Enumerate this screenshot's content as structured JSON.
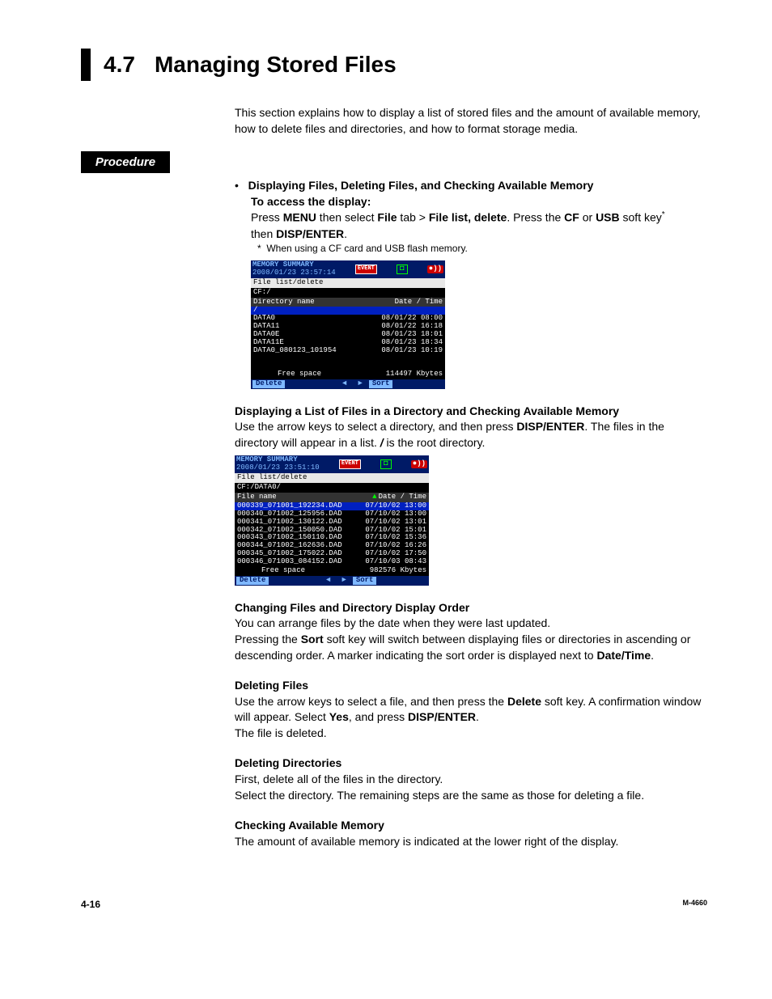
{
  "section": {
    "number": "4.7",
    "title": "Managing Stored Files"
  },
  "intro": "This section explains how to display a list of stored files and the amount of available memory, how to delete files and directories, and how to format storage media.",
  "procedure_label": "Procedure",
  "proc1": {
    "heading": "Displaying Files, Deleting Files, and Checking Available Memory",
    "line2": "To access the display:",
    "press": "Press ",
    "menu": "MENU",
    "then_select": " then select ",
    "file": "File",
    "tab_gt": " tab > ",
    "file_list_delete": "File list, delete",
    "press_the": ". Press the ",
    "cf": "CF",
    "or": " or ",
    "usb": "USB",
    "soft_key": " soft key",
    "then": "then ",
    "disp_enter": "DISP/ENTER",
    "period": ".",
    "footnote_mark": "*",
    "footnote": "When using a CF card and USB flash memory."
  },
  "screen1": {
    "title1": "MEMORY SUMMARY",
    "title2": "2008/01/23 23:57:14",
    "event": "EVENT",
    "subbar": "File list/delete",
    "path": "CF:/",
    "col_left": "Directory name",
    "col_right": "Date / Time",
    "rows": [
      {
        "n": "/",
        "d": "",
        "hi": true
      },
      {
        "n": "DATA0",
        "d": "08/01/22 08:00"
      },
      {
        "n": "DATA11",
        "d": "08/01/22 16:18"
      },
      {
        "n": "DATA0E",
        "d": "08/01/23 18:01"
      },
      {
        "n": "DATA11E",
        "d": "08/01/23 18:34"
      },
      {
        "n": "DATA0_080123_101954",
        "d": "08/01/23 10:19"
      }
    ],
    "free_label": "Free space",
    "free_value": "114497 Kbytes",
    "btn_delete": "Delete",
    "btn_sort": "Sort"
  },
  "proc2": {
    "heading": "Displaying a List of Files in a Directory and Checking Available Memory",
    "t1": "Use the arrow keys to select a directory, and then press ",
    "disp_enter": "DISP/ENTER",
    "t2": ". The files in the directory will appear in a list. ",
    "root": "/",
    "t3": " is the root directory."
  },
  "screen2": {
    "title1": "MEMORY SUMMARY",
    "title2": "2008/01/23 23:51:10",
    "event": "EVENT",
    "subbar": "File list/delete",
    "path": "CF:/DATA0/",
    "col_left": "File name",
    "col_right": "Date / Time",
    "rows": [
      {
        "n": "000339_071001_192234.DAD",
        "d": "07/10/02 13:00",
        "hi": true
      },
      {
        "n": "000340_071002_125956.DAD",
        "d": "07/10/02 13:00"
      },
      {
        "n": "000341_071002_130122.DAD",
        "d": "07/10/02 13:01"
      },
      {
        "n": "000342_071002_150050.DAD",
        "d": "07/10/02 15:01"
      },
      {
        "n": "000343_071002_150110.DAD",
        "d": "07/10/02 15:36"
      },
      {
        "n": "000344_071002_162636.DAD",
        "d": "07/10/02 16:26"
      },
      {
        "n": "000345_071002_175022.DAD",
        "d": "07/10/02 17:50"
      },
      {
        "n": "000346_071003_084152.DAD",
        "d": "07/10/03 08:43"
      }
    ],
    "free_label": "Free space",
    "free_value": "982576 Kbytes",
    "btn_delete": "Delete",
    "btn_sort": "Sort"
  },
  "proc3": {
    "heading": "Changing Files and Directory Display Order",
    "l1": "You can arrange files by the date when they were last updated.",
    "l2a": "Pressing the ",
    "sort": "Sort",
    "l2b": " soft key will switch between displaying files or directories in ascending or descending order. A marker indicating the sort order is displayed next to ",
    "dt": "Date/Time",
    "period": "."
  },
  "proc4": {
    "heading": "Deleting Files",
    "l1a": "Use the arrow keys to select a file, and then press the ",
    "delete": "Delete",
    "l1b": " soft key. A confirmation window will appear. Select ",
    "yes": "Yes",
    "l1c": ", and press ",
    "disp_enter": "DISP/ENTER",
    "period": ".",
    "l2": "The file is deleted."
  },
  "proc5": {
    "heading": "Deleting Directories",
    "l1": "First, delete all of the files in the directory.",
    "l2": "Select the directory. The remaining steps are the same as those for deleting a file."
  },
  "proc6": {
    "heading": "Checking Available Memory",
    "l1": "The amount of available memory is indicated at the lower right of the display."
  },
  "footer": {
    "left": "4-16",
    "right": "M-4660"
  },
  "glyph": {
    "cam": "◘",
    "rec": "●))",
    "left": "◄",
    "right": "►",
    "up": "▲"
  }
}
